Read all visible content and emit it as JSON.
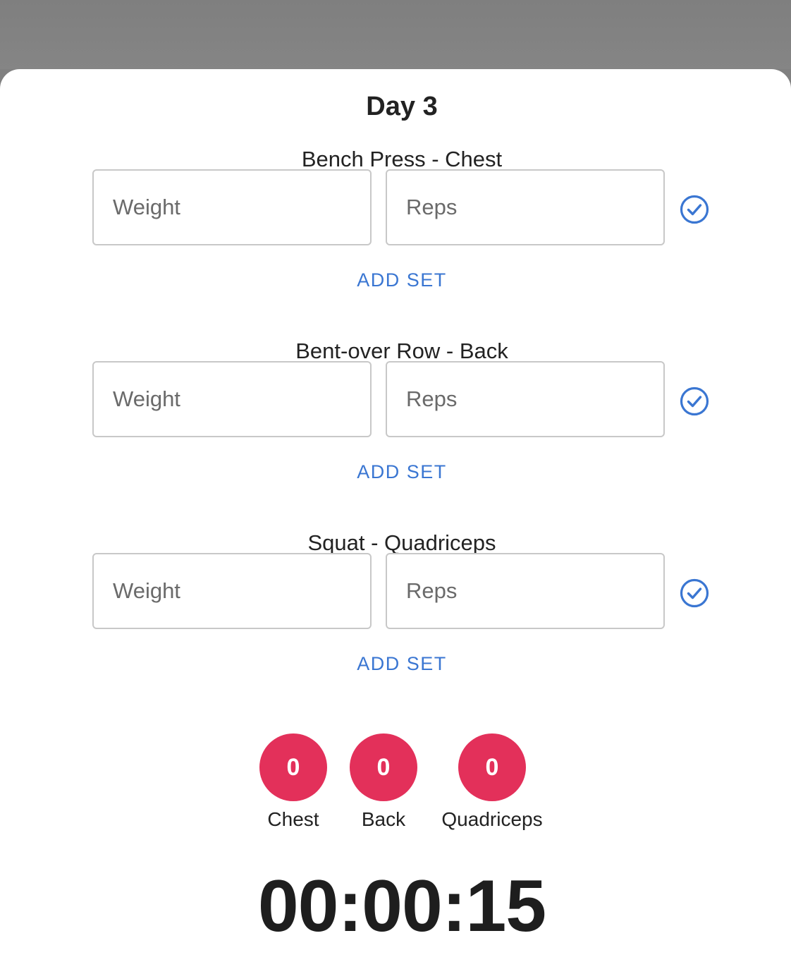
{
  "workout": {
    "title": "Day 3"
  },
  "exercises": [
    {
      "name": "Bench Press - Chest",
      "weight_placeholder": "Weight",
      "reps_placeholder": "Reps",
      "weight_value": "",
      "reps_value": "",
      "add_set_label": "ADD SET"
    },
    {
      "name": "Bent-over Row - Back",
      "weight_placeholder": "Weight",
      "reps_placeholder": "Reps",
      "weight_value": "",
      "reps_value": "",
      "add_set_label": "ADD SET"
    },
    {
      "name": "Squat - Quadriceps",
      "weight_placeholder": "Weight",
      "reps_placeholder": "Reps",
      "weight_value": "",
      "reps_value": "",
      "add_set_label": "ADD SET"
    }
  ],
  "muscle_counters": [
    {
      "count": "0",
      "label": "Chest"
    },
    {
      "count": "0",
      "label": "Back"
    },
    {
      "count": "0",
      "label": "Quadriceps"
    }
  ],
  "timer": {
    "value": "00:00:15"
  },
  "icons": {
    "complete_set": "check-circle-icon"
  },
  "colors": {
    "accent": "#3a76d2",
    "counter_badge": "#e3305a",
    "backdrop": "#808080"
  }
}
